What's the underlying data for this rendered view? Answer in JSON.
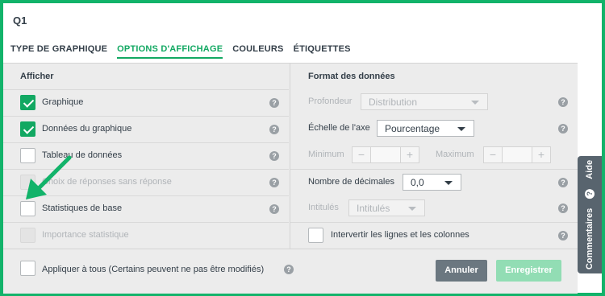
{
  "header": {
    "title": "Q1"
  },
  "tabs": [
    {
      "label": "TYPE DE GRAPHIQUE",
      "active": false
    },
    {
      "label": "OPTIONS D'AFFICHAGE",
      "active": true
    },
    {
      "label": "COULEURS",
      "active": false
    },
    {
      "label": "ÉTIQUETTES",
      "active": false
    }
  ],
  "afficher": {
    "heading": "Afficher",
    "items": [
      {
        "label": "Graphique",
        "checked": true,
        "disabled": false
      },
      {
        "label": "Données du graphique",
        "checked": true,
        "disabled": false
      },
      {
        "label": "Tableau de données",
        "checked": false,
        "disabled": false
      },
      {
        "label": "Choix de réponses sans réponse",
        "checked": false,
        "disabled": true
      },
      {
        "label": "Statistiques de base",
        "checked": false,
        "disabled": false
      },
      {
        "label": "Importance statistique",
        "checked": false,
        "disabled": true
      }
    ]
  },
  "format": {
    "heading": "Format des données",
    "profondeur": {
      "label": "Profondeur",
      "value": "Distribution"
    },
    "echelle": {
      "label": "Échelle de l'axe",
      "value": "Pourcentage"
    },
    "minimum": {
      "label": "Minimum",
      "minus": "−",
      "plus": "+"
    },
    "maximum": {
      "label": "Maximum",
      "minus": "−",
      "plus": "+"
    },
    "decimales": {
      "label": "Nombre de décimales",
      "value": "0,0"
    },
    "intitules": {
      "label": "Intitulés",
      "value": "Intitulés"
    },
    "intervertir": {
      "label": "Intervertir les lignes et les colonnes",
      "checked": false
    }
  },
  "footer": {
    "apply_all_label": "Appliquer à tous (Certains peuvent ne pas être modifiés)",
    "cancel_label": "Annuler",
    "save_label": "Enregistrer"
  },
  "side": {
    "feedback_label": "Commentaires",
    "help_label": "Aide"
  },
  "help_glyph": "?",
  "colors": {
    "accent": "#12a862",
    "frame": "#12b36a",
    "arrow": "#12b36a",
    "cancel_button": "#6b7780",
    "save_button_disabled": "#92ddb4",
    "side_tab": "#58646e"
  }
}
